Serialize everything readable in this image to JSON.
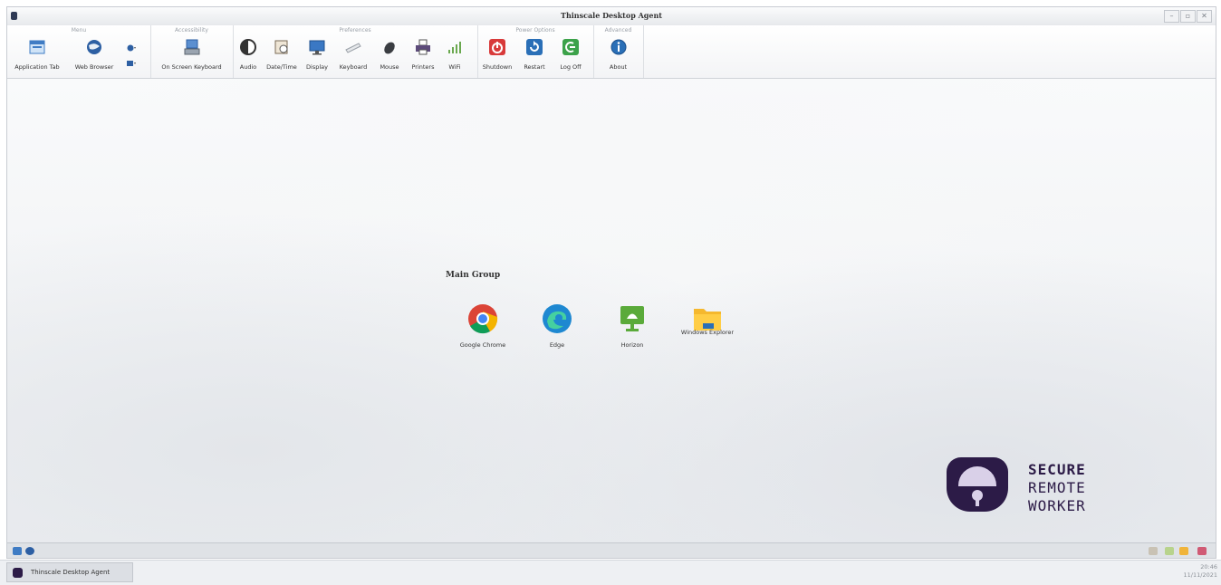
{
  "window": {
    "title": "Thinscale Desktop Agent",
    "controls": {
      "minimize": "–",
      "maximize": "▫",
      "close": "✕"
    }
  },
  "ribbon": {
    "groups": [
      {
        "label": "Menu",
        "buttons": [
          "Application Tab",
          "Web Browser"
        ]
      },
      {
        "label": "Accessibility",
        "buttons": [
          "On Screen Keyboard"
        ]
      },
      {
        "label": "Preferences",
        "buttons": [
          "Audio",
          "Date/Time",
          "Display",
          "Keyboard",
          "Mouse",
          "Printers",
          "WiFi"
        ]
      },
      {
        "label": "Power Options",
        "buttons": [
          "Shutdown",
          "Restart",
          "Log Off"
        ]
      },
      {
        "label": "Advanced",
        "buttons": [
          "About"
        ]
      }
    ]
  },
  "desktop": {
    "group_title": "Main Group",
    "icons": [
      {
        "label": "Google Chrome",
        "icon": "chrome-icon"
      },
      {
        "label": "Edge",
        "icon": "edge-icon"
      },
      {
        "label": "Horizon",
        "icon": "horizon-icon"
      },
      {
        "label": "Windows Explorer",
        "icon": "folder-icon"
      }
    ]
  },
  "brand": {
    "line1": "SECURE",
    "line2": "REMOTE",
    "line3": "WORKER"
  },
  "taskbar": {
    "task_label": "Thinscale Desktop Agent",
    "time": "20:46",
    "date": "11/11/2021"
  },
  "colors": {
    "brand": "#2c1b47",
    "power_red": "#d83a3a",
    "power_blue": "#2a6fb7",
    "power_green": "#3ca24a"
  }
}
